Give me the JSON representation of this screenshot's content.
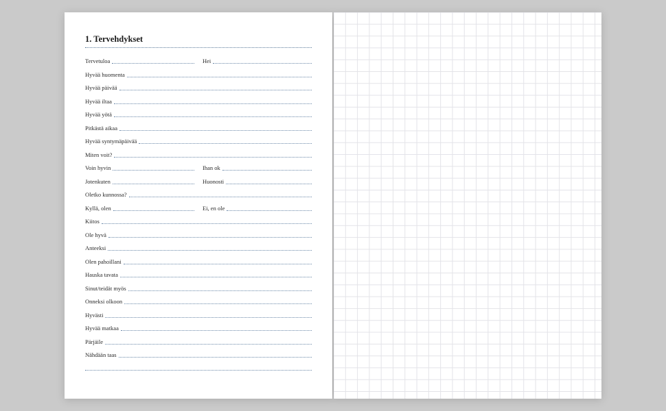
{
  "heading": "1. Tervehdykset",
  "rows": [
    {
      "type": "split",
      "left": "Tervetuloa",
      "right": "Hei"
    },
    {
      "type": "full",
      "term": "Hyvää huomenta"
    },
    {
      "type": "full",
      "term": "Hyvää päivää"
    },
    {
      "type": "full",
      "term": "Hyvää iltaa"
    },
    {
      "type": "full",
      "term": "Hyvää yötä"
    },
    {
      "type": "full",
      "term": "Pitkästä aikaa"
    },
    {
      "type": "full",
      "term": "Hyvää syntymäpäivää"
    },
    {
      "type": "full",
      "term": "Miten voit?"
    },
    {
      "type": "split",
      "left": "Voin hyvin",
      "right": "Ihan ok"
    },
    {
      "type": "split",
      "left": "Jotenkuten",
      "right": "Huonosti"
    },
    {
      "type": "full",
      "term": "Oletko kunnossa?"
    },
    {
      "type": "split",
      "left": "Kyllä, olen",
      "right": "Ei, en ole"
    },
    {
      "type": "full",
      "term": "Kiitos"
    },
    {
      "type": "full",
      "term": "Ole hyvä"
    },
    {
      "type": "full",
      "term": "Anteeksi"
    },
    {
      "type": "full",
      "term": "Olen pahoillani"
    },
    {
      "type": "full",
      "term": "Hauska tavata"
    },
    {
      "type": "full",
      "term": "Sinut/teidät myös"
    },
    {
      "type": "full",
      "term": "Onneksi olkoon"
    },
    {
      "type": "full",
      "term": "Hyvästi"
    },
    {
      "type": "full",
      "term": "Hyvää matkaa"
    },
    {
      "type": "full",
      "term": "Pärjäile"
    },
    {
      "type": "full",
      "term": "Nähdään taas"
    },
    {
      "type": "blank"
    }
  ]
}
